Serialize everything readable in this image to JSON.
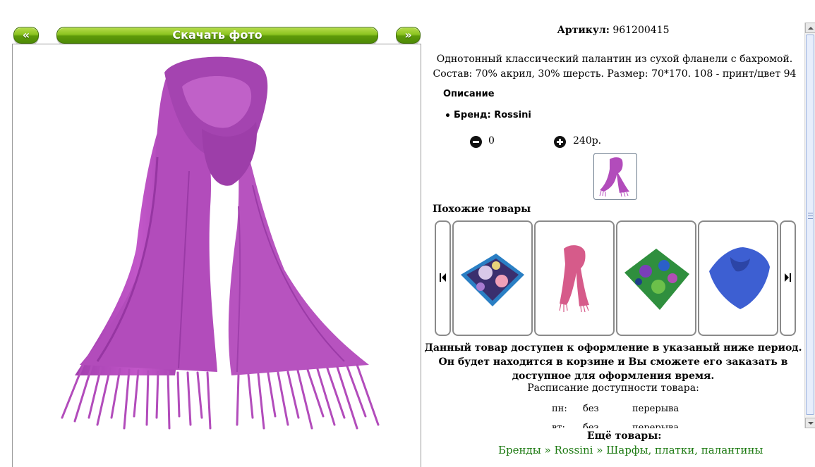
{
  "toolbar": {
    "prev_label": "«",
    "download_label": "Скачать фото",
    "next_label": "»"
  },
  "product": {
    "article_label": "Артикул:",
    "article_value": "961200415",
    "description": "Однотонный классический палантин из сухой фланели с бахромой. Состав: 70% акрил, 30% шерсть. Размер: 70*170. 108 - принт/цвет 94",
    "section_title": "Описание",
    "brand_line": "Бренд: Rossini",
    "quantity": "0",
    "price": "240р."
  },
  "similar": {
    "title": "Похожие товары"
  },
  "availability": {
    "notice": "Данный товар доступен к оформление в указаный ниже период. Он будет находится в корзине и Вы сможете его заказать в доступное для оформления время.",
    "schedule_title": "Расписание доступности товара:",
    "rows": [
      {
        "day": "пн:",
        "from": "без",
        "to": "перерыва"
      },
      {
        "day": "вт:",
        "from": "без",
        "to": "перерыва"
      }
    ]
  },
  "more": {
    "title": "Ещё товары:"
  },
  "breadcrumbs": {
    "items": [
      "Бренды",
      "Rossini",
      "Шарфы, платки, палантины"
    ],
    "separator": "»"
  },
  "colors": {
    "accent_green": "#7ab317",
    "scarf": "#b94fc0",
    "link": "#1d7a12"
  }
}
